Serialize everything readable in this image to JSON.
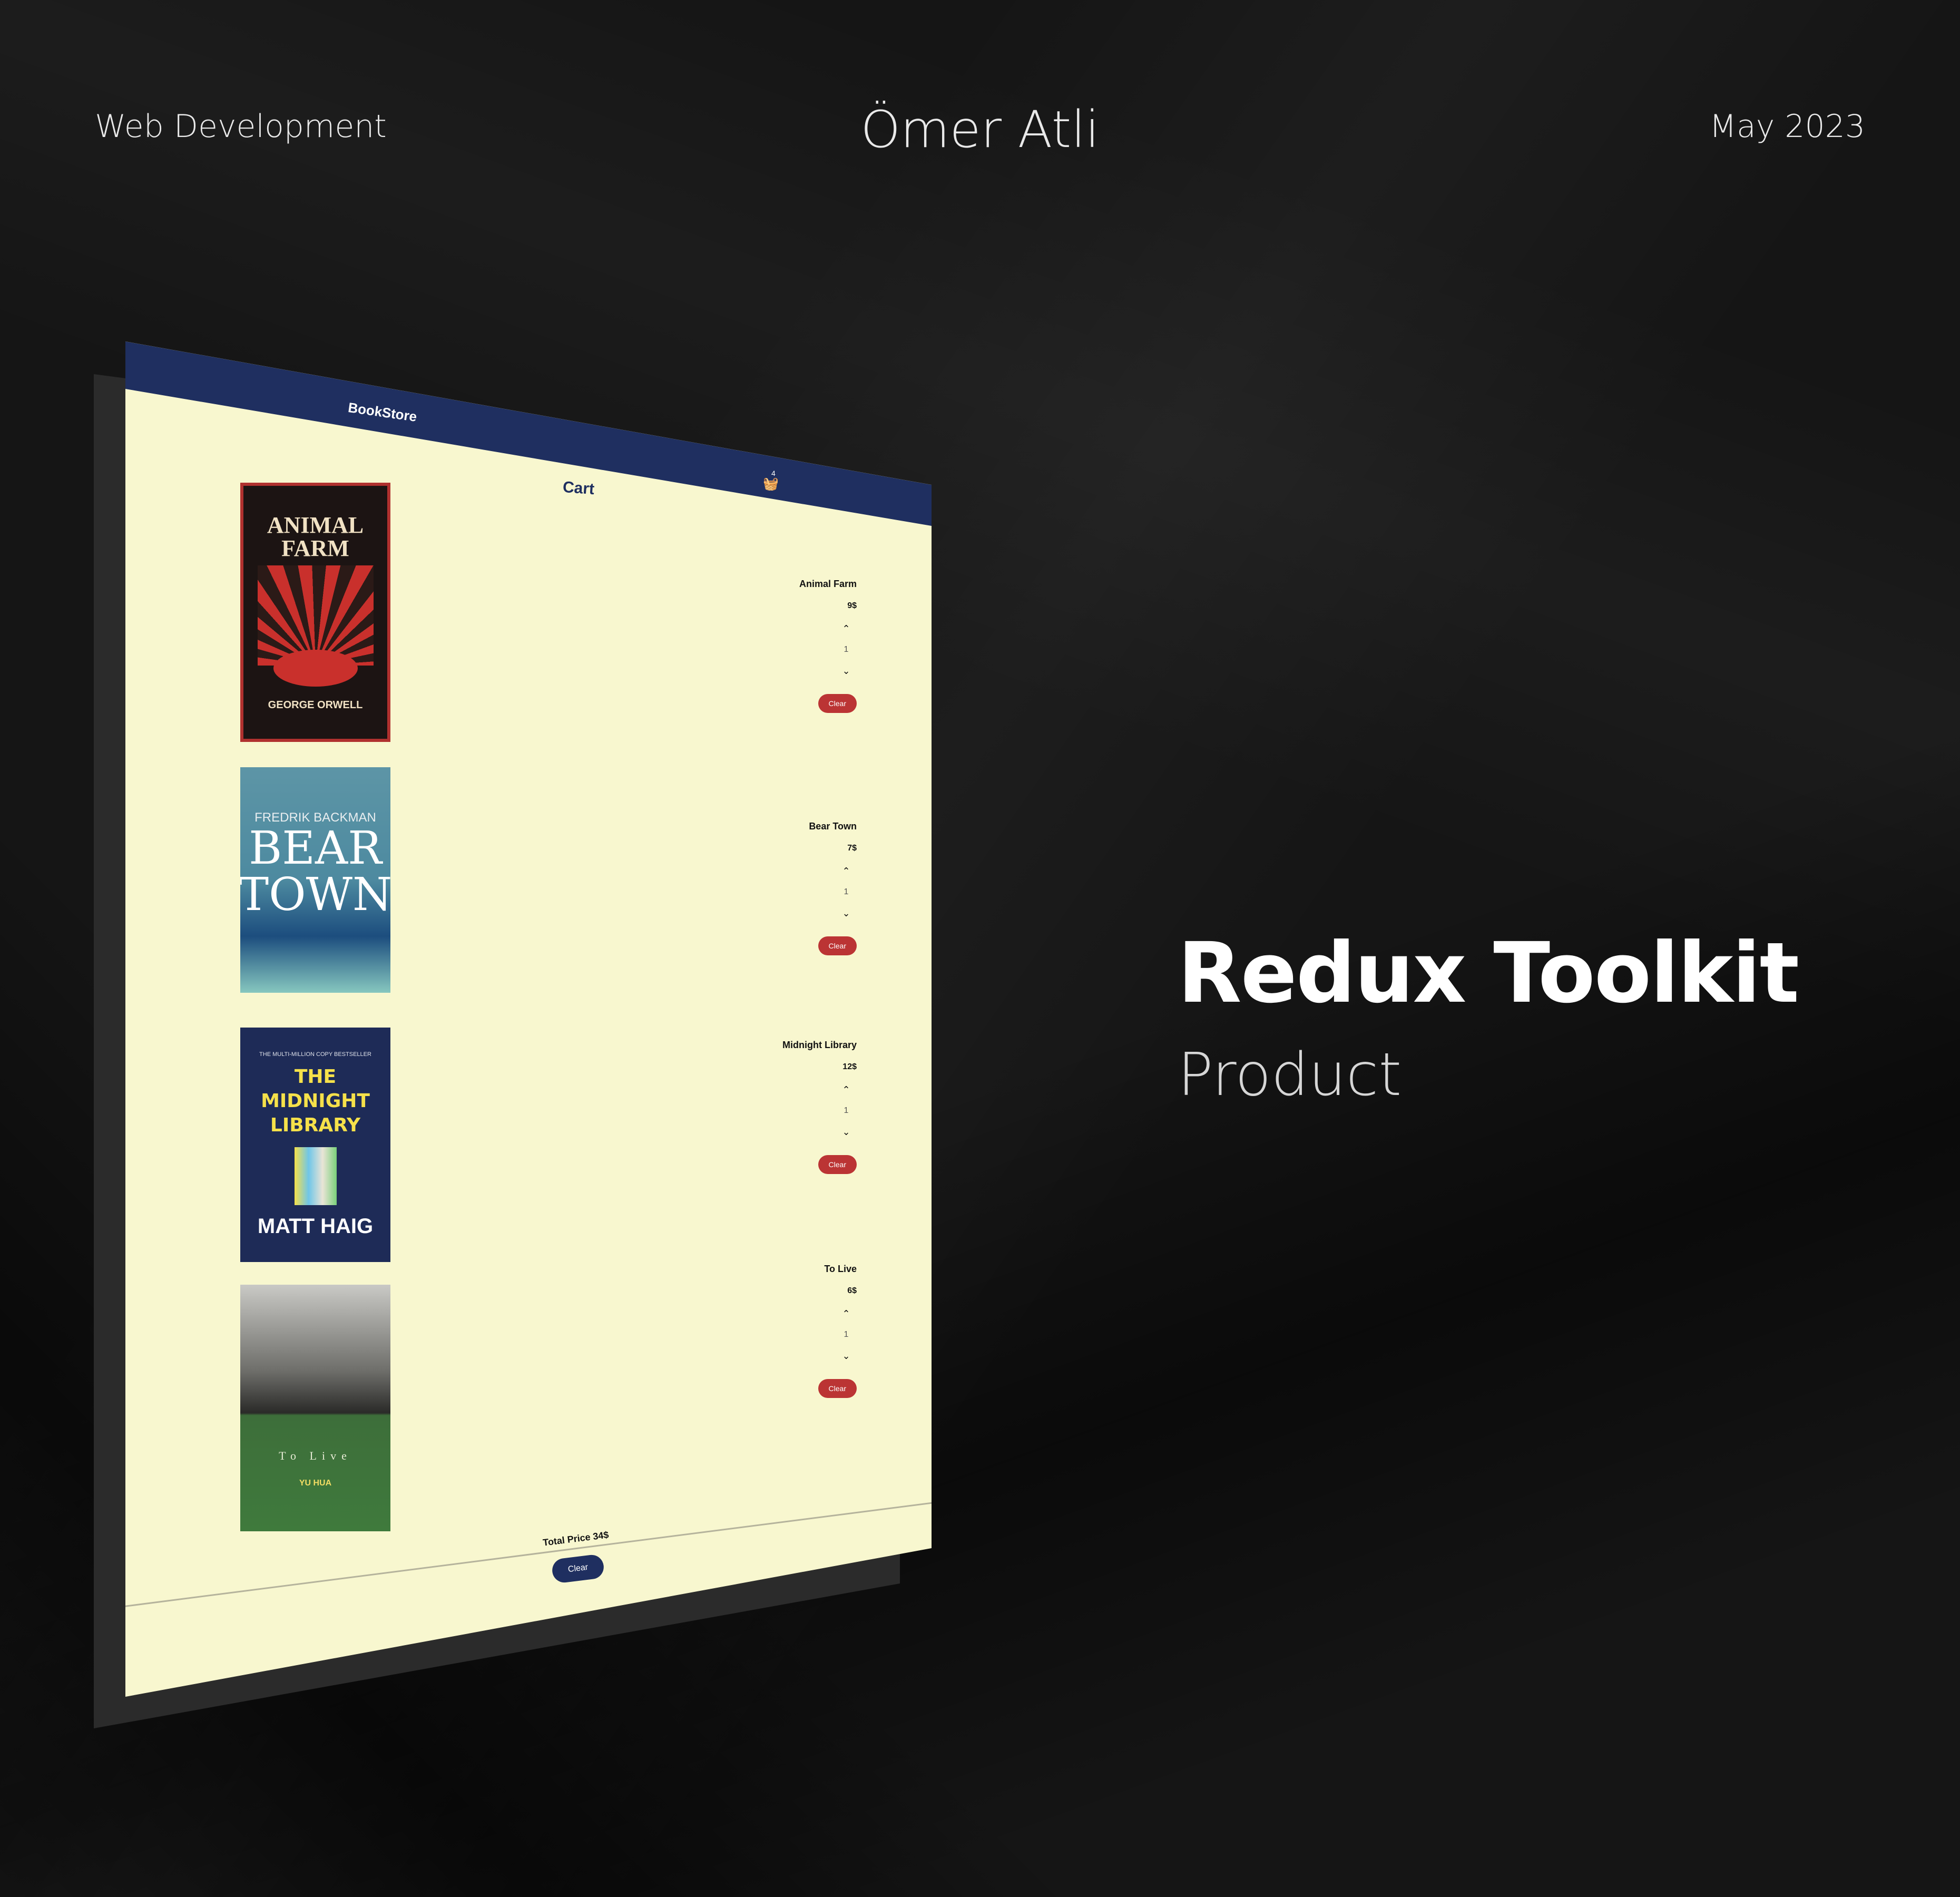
{
  "header": {
    "category": "Web Development",
    "author": "Ömer Atli",
    "date": "May 2023"
  },
  "hero": {
    "title": "Redux Toolkit",
    "subtitle": "Product"
  },
  "app": {
    "brand": "BookStore",
    "cart_title": "Cart",
    "basket_count": "4",
    "items": [
      {
        "name": "Animal Farm",
        "price": "9$",
        "qty": "1",
        "clear": "Clear"
      },
      {
        "name": "Bear Town",
        "price": "7$",
        "qty": "1",
        "clear": "Clear"
      },
      {
        "name": "Midnight Library",
        "price": "12$",
        "qty": "1",
        "clear": "Clear"
      },
      {
        "name": "To Live",
        "price": "6$",
        "qty": "1",
        "clear": "Clear"
      }
    ],
    "covers": {
      "animal_farm": {
        "title": "ANIMAL FARM",
        "author": "GEORGE ORWELL"
      },
      "bear_town": {
        "author": "FREDRIK BACKMAN",
        "title": "BEAR TOWN"
      },
      "midnight": {
        "tagline": "THE MULTI-MILLION COPY BESTSELLER",
        "title": "THE MIDNIGHT LIBRARY",
        "author": "MATT HAIG"
      },
      "to_live": {
        "title": "To Live",
        "author": "YU HUA"
      }
    },
    "total": "Total Price 34$",
    "clear_all": "Clear"
  },
  "colors": {
    "navbar": "#1f2f60",
    "page": "#f8f7cf",
    "clear_button": "#bb3434"
  }
}
